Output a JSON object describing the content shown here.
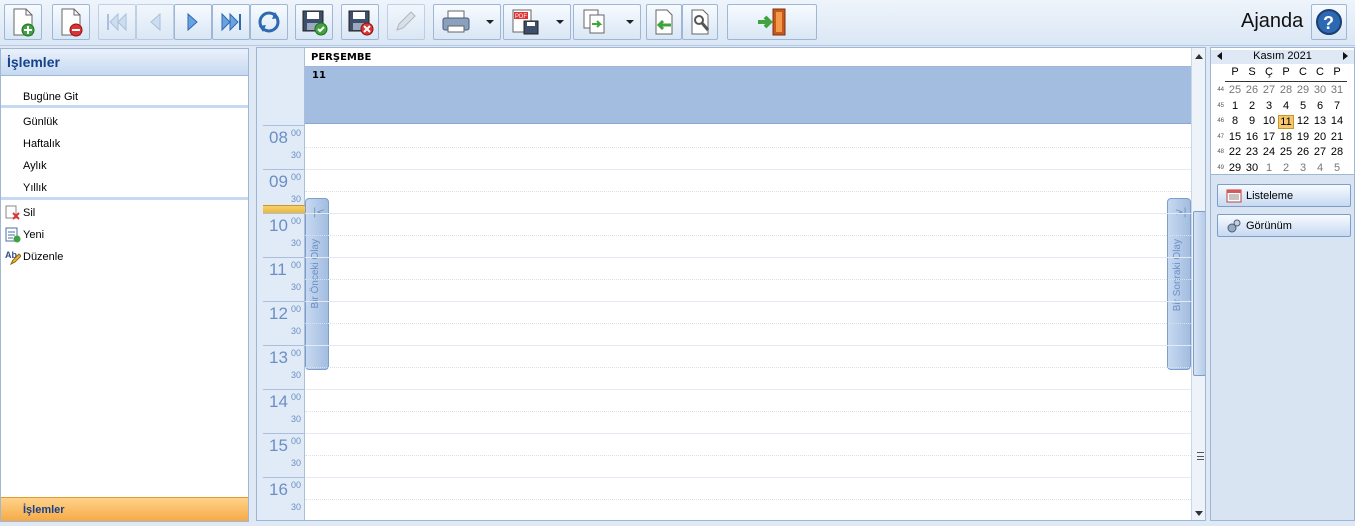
{
  "app": {
    "title": "Ajanda"
  },
  "toolbar": {
    "buttons": [
      "new-icon",
      "delete-icon",
      "first-icon",
      "prev-icon",
      "next-icon",
      "last-icon",
      "refresh-icon",
      "save-icon",
      "save-close-icon",
      "edit-icon",
      "print-icon",
      "pdf-export-icon",
      "copy-icon",
      "back-icon",
      "search-settings-icon",
      "exit-icon"
    ],
    "help": "help-icon"
  },
  "left_panel": {
    "title": "İşlemler",
    "nav": [
      "Bugüne Git",
      "Günlük",
      "Haftalık",
      "Aylık",
      "Yıllık"
    ],
    "actions": [
      {
        "label": "Sil",
        "icon": "delete-icon"
      },
      {
        "label": "Yeni",
        "icon": "new-icon"
      },
      {
        "label": "Düzenle",
        "icon": "edit-text-icon"
      }
    ],
    "footer": "İşlemler"
  },
  "scheduler": {
    "day_name": "PERŞEMBE",
    "day_number": "11",
    "hours": [
      "08",
      "09",
      "10",
      "11",
      "12",
      "13",
      "14",
      "15",
      "16"
    ],
    "minute_on": "00",
    "minute_half": "30",
    "prev_label": "Bir Önceki Olay",
    "next_label": "Bir Sonraki Olay"
  },
  "calendar": {
    "month_label": "Kasım 2021",
    "weekdays": [
      "P",
      "S",
      "Ç",
      "P",
      "C",
      "C",
      "P"
    ],
    "weeks": [
      {
        "num": "44",
        "days": [
          "25",
          "26",
          "27",
          "28",
          "29",
          "30",
          "31"
        ]
      },
      {
        "num": "45",
        "days": [
          "1",
          "2",
          "3",
          "4",
          "5",
          "6",
          "7"
        ]
      },
      {
        "num": "46",
        "days": [
          "8",
          "9",
          "10",
          "11",
          "12",
          "13",
          "14"
        ]
      },
      {
        "num": "47",
        "days": [
          "15",
          "16",
          "17",
          "18",
          "19",
          "20",
          "21"
        ]
      },
      {
        "num": "48",
        "days": [
          "22",
          "23",
          "24",
          "25",
          "26",
          "27",
          "28"
        ]
      },
      {
        "num": "49",
        "days": [
          "29",
          "30",
          "1",
          "2",
          "3",
          "4",
          "5"
        ]
      }
    ],
    "selected_day": "11"
  },
  "right_panel": {
    "buttons": [
      {
        "label": "Listeleme",
        "icon": "list-icon"
      },
      {
        "label": "Görünüm",
        "icon": "view-settings-icon"
      }
    ]
  }
}
